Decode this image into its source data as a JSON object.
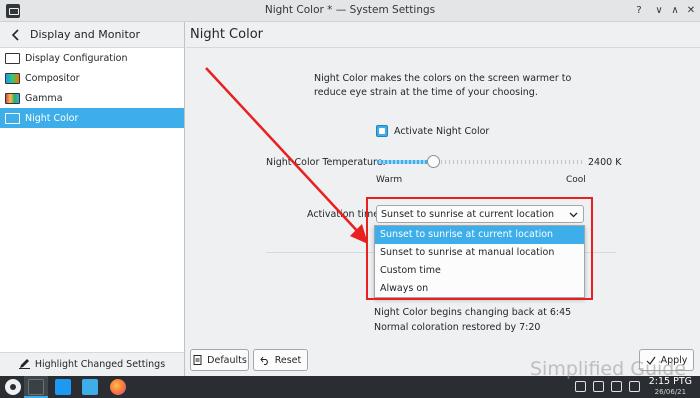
{
  "window": {
    "title": "Night Color * — System Settings",
    "help": "?",
    "minimize": "∨",
    "maximize": "∧",
    "close": "✕"
  },
  "sidebar": {
    "header": "Display and Monitor",
    "items": [
      {
        "label": "Display Configuration",
        "icon": "display-icon",
        "active": false
      },
      {
        "label": "Compositor",
        "icon": "compositor-icon",
        "active": false
      },
      {
        "label": "Gamma",
        "icon": "gamma-icon",
        "active": false
      },
      {
        "label": "Night Color",
        "icon": "night-color-icon",
        "active": true
      }
    ],
    "footer": "Highlight Changed Settings"
  },
  "main": {
    "title": "Night Color",
    "description": "Night Color makes the colors on the screen warmer to reduce eye strain at the time of your choosing.",
    "activate_label": "Activate Night Color",
    "activate_checked": true,
    "temperature_label": "Night Color Temperature:",
    "temperature_value": "2400 K",
    "temperature_fraction": 0.27,
    "warm_label": "Warm",
    "cool_label": "Cool",
    "activation_label": "Activation time:",
    "activation_selected": "Sunset to sunrise at current location",
    "activation_options": [
      "Sunset to sunrise at current location",
      "Sunset to sunrise at manual location",
      "Custom time",
      "Always on"
    ],
    "info_begin": "Night Color begins changing back at 6:45",
    "info_restore": "Normal coloration restored by 7:20"
  },
  "buttons": {
    "defaults": "Defaults",
    "reset": "Reset",
    "apply": "Apply"
  },
  "taskbar": {
    "time": "2:15 PTG",
    "date": "26/06/21"
  },
  "watermark": "Simplified Guide",
  "colors": {
    "accent": "#3daee9",
    "highlight_box": "#e8201f",
    "taskbar": "#2a2e32"
  }
}
